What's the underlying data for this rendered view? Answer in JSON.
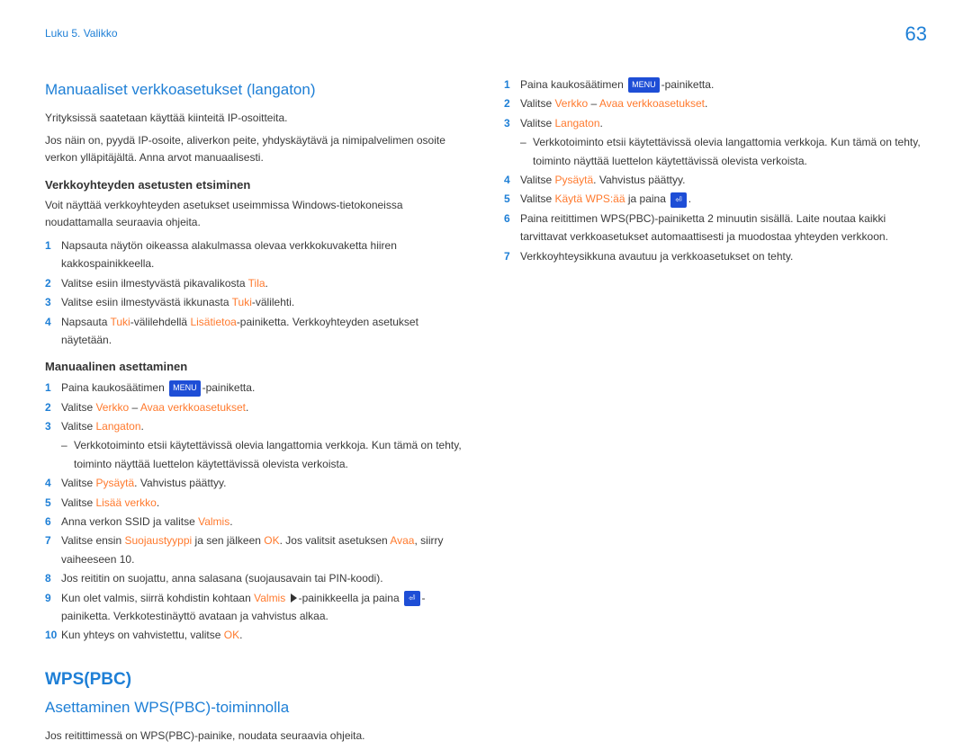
{
  "page_number": "63",
  "breadcrumb": "Luku 5. Valikko",
  "left": {
    "h1": "Manuaaliset verkkoasetukset (langaton)",
    "p1": "Yrityksissä saatetaan käyttää kiinteitä IP-osoitteita.",
    "p2": "Jos näin on, pyydä IP-osoite, aliverkon peite, yhdyskäytävä ja nimipalvelimen osoite verkon ylläpitäjältä. Anna arvot manuaalisesti.",
    "sub1": "Verkkoyhteyden asetusten etsiminen",
    "p3": "Voit näyttää verkkoyhteyden asetukset useimmissa Windows-tietokoneissa noudattamalla seuraavia ohjeita.",
    "l1": {
      "n1": "1",
      "t1": "Napsauta näytön oikeassa alakulmassa olevaa verkkokuvaketta hiiren kakkospainikkeella.",
      "n2": "2",
      "t2a": "Valitse esiin ilmestyvästä pikavalikosta ",
      "t2b": "Tila",
      "t2c": ".",
      "n3": "3",
      "t3a": "Valitse esiin ilmestyvästä ikkunasta ",
      "t3b": "Tuki",
      "t3c": "-välilehti.",
      "n4": "4",
      "t4a": "Napsauta ",
      "t4b": "Tuki",
      "t4c": "-välilehdellä ",
      "t4d": "Lisätietoa",
      "t4e": "-painiketta. Verkkoyhteyden asetukset näytetään."
    },
    "sub2": "Manuaalinen asettaminen",
    "l2": {
      "n1": "1",
      "t1a": "Paina kaukosäätimen ",
      "menu": "MENU",
      "t1b": "-painiketta.",
      "n2": "2",
      "t2a": "Valitse ",
      "t2b": "Verkko",
      "t2c": " – ",
      "t2d": "Avaa verkkoasetukset",
      "t2e": ".",
      "n3": "3",
      "t3a": "Valitse ",
      "t3b": "Langaton",
      "t3c": ".",
      "dash1": "Verkkotoiminto etsii käytettävissä olevia langattomia verkkoja. Kun tämä on tehty, toiminto näyttää luettelon käytettävissä olevista verkoista.",
      "n4": "4",
      "t4a": "Valitse ",
      "t4b": "Pysäytä",
      "t4c": ". Vahvistus päättyy.",
      "n5": "5",
      "t5a": "Valitse ",
      "t5b": "Lisää verkko",
      "t5c": ".",
      "n6": "6",
      "t6a": "Anna verkon SSID ja valitse ",
      "t6b": "Valmis",
      "t6c": ".",
      "n7": "7",
      "t7a": "Valitse ensin ",
      "t7b": "Suojaustyyppi",
      "t7c": " ja sen jälkeen ",
      "t7d": "OK",
      "t7e": ". Jos valitsit asetuksen ",
      "t7f": "Avaa",
      "t7g": ", siirry vaiheeseen 10.",
      "n8": "8",
      "t8": "Jos reititin on suojattu, anna salasana (suojausavain tai PIN-koodi).",
      "n9": "9",
      "t9a": "Kun olet valmis, siirrä kohdistin kohtaan ",
      "t9b": "Valmis",
      "t9c": " ",
      "t9d": "-painikkeella ja paina ",
      "enter": "⏎",
      "t9e": "-painiketta. Verkkotestinäyttö avataan ja vahvistus alkaa.",
      "n10": "10",
      "t10a": "Kun yhteys on vahvistettu, valitse ",
      "t10b": "OK",
      "t10c": "."
    },
    "h2": "WPS(PBC)",
    "h3": "Asettaminen WPS(PBC)-toiminnolla",
    "p4": "Jos reitittimessä on WPS(PBC)-painike, noudata seuraavia ohjeita."
  },
  "right": {
    "l3": {
      "n1": "1",
      "t1a": "Paina kaukosäätimen ",
      "menu": "MENU",
      "t1b": "-painiketta.",
      "n2": "2",
      "t2a": "Valitse ",
      "t2b": "Verkko",
      "t2c": " – ",
      "t2d": "Avaa verkkoasetukset",
      "t2e": ".",
      "n3": "3",
      "t3a": "Valitse ",
      "t3b": "Langaton",
      "t3c": ".",
      "dash1": "Verkkotoiminto etsii käytettävissä olevia langattomia verkkoja. Kun tämä on tehty, toiminto näyttää luettelon käytettävissä olevista verkoista.",
      "n4": "4",
      "t4a": "Valitse ",
      "t4b": "Pysäytä",
      "t4c": ". Vahvistus päättyy.",
      "n5": "5",
      "t5a": "Valitse ",
      "t5b": "Käytä WPS:ää",
      "t5c": " ja paina ",
      "enter": "⏎",
      "t5d": ".",
      "n6": "6",
      "t6": "Paina reitittimen WPS(PBC)-painiketta 2 minuutin sisällä. Laite noutaa kaikki tarvittavat verkkoasetukset automaattisesti ja muodostaa yhteyden verkkoon.",
      "n7": "7",
      "t7": "Verkkoyhteysikkuna avautuu ja verkkoasetukset on tehty."
    }
  }
}
